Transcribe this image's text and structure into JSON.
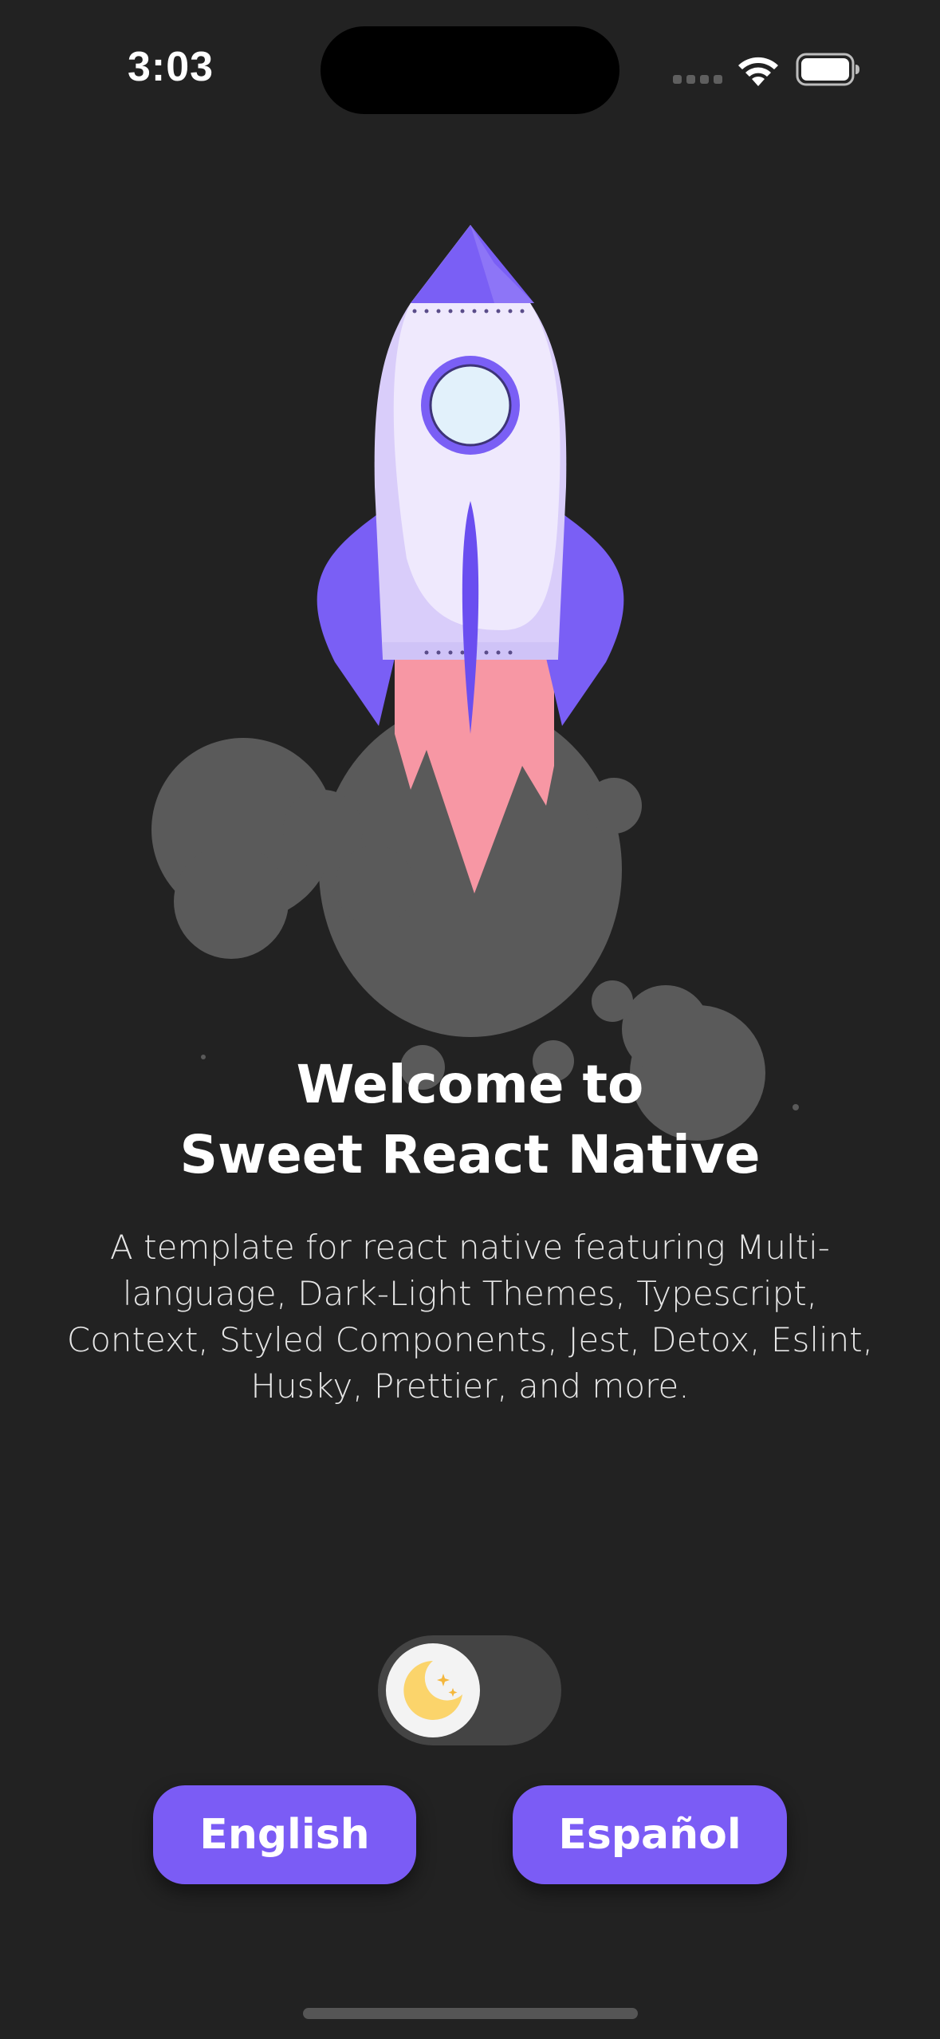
{
  "status_bar": {
    "time": "3:03",
    "icons": [
      "cellular-signal-icon",
      "wifi-icon",
      "battery-icon"
    ]
  },
  "hero": {
    "illustration": "rocket-launch-illustration"
  },
  "welcome": {
    "line1": "Welcome to",
    "line2": "Sweet React Native",
    "description": "A template for react native featuring Multi-language, Dark-Light Themes, Typescript, Context, Styled Components, Jest, Detox, Eslint, Husky, Prettier, and more."
  },
  "theme_toggle": {
    "icon": "moon-icon",
    "state": "dark"
  },
  "language_buttons": {
    "english": "English",
    "spanish": "Español"
  },
  "colors": {
    "background": "#222222",
    "accent": "#7b5cf5",
    "flame": "#f797a4",
    "smoke": "#5a5a5a"
  }
}
